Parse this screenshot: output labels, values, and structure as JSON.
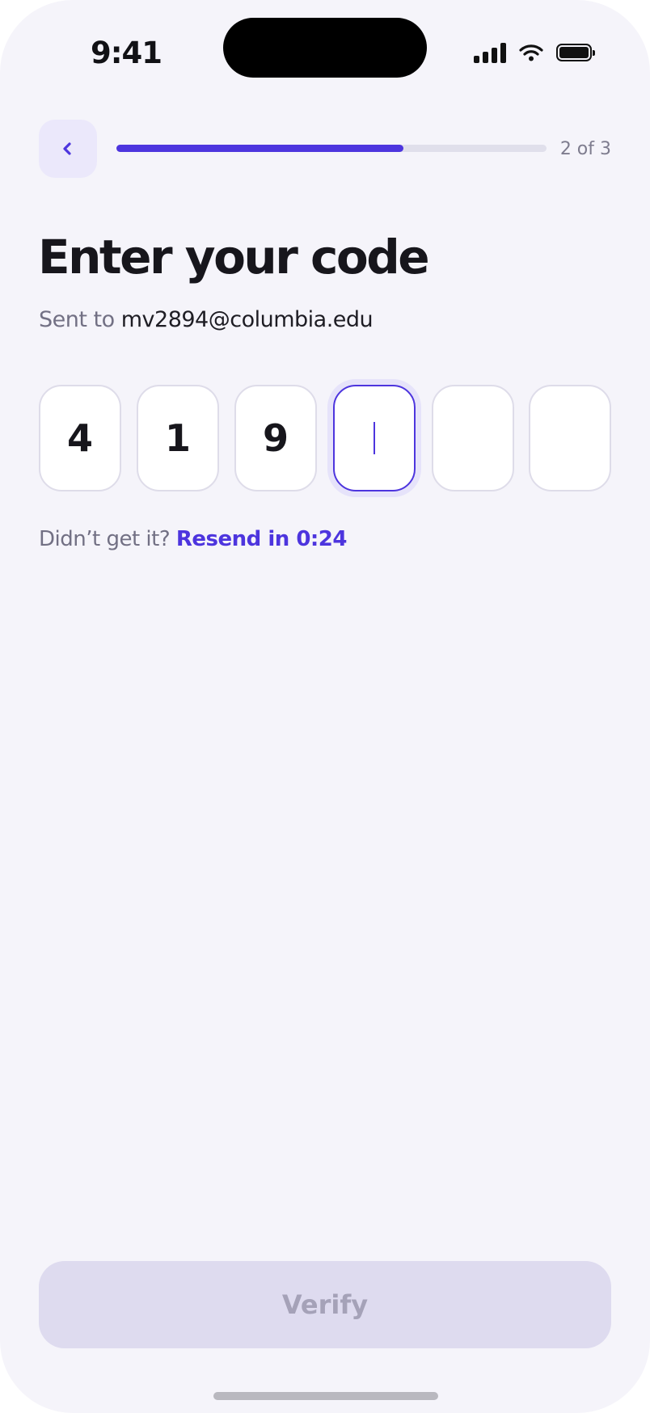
{
  "status_bar": {
    "time": "9:41"
  },
  "header": {
    "back_icon": "chevron-left-icon",
    "progress": 0.667,
    "step_label": "2 of 3"
  },
  "title": "Enter your code",
  "subtitle": {
    "prefix": "Sent to",
    "email": "mv2894@columbia.edu"
  },
  "code": {
    "digits": [
      "4",
      "1",
      "9",
      "",
      "",
      ""
    ],
    "active_index": 3
  },
  "resend": {
    "prompt": "Didn’t get it?",
    "link": "Resend in 0:24"
  },
  "verify_button": {
    "label": "Verify",
    "disabled": true
  },
  "colors": {
    "accent": "#4d35de",
    "background": "#f5f4fa"
  }
}
